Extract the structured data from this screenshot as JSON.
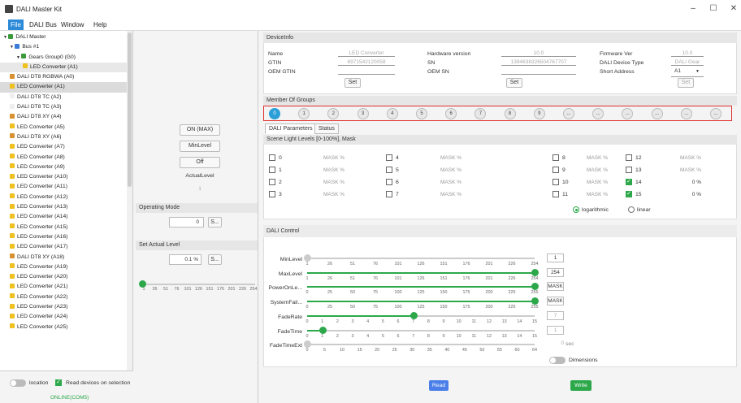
{
  "window": {
    "title": "DALI Master Kit",
    "min": "–",
    "max": "☐",
    "close": "✕"
  },
  "menu": [
    "File",
    "DALI Bus",
    "Window",
    "Help"
  ],
  "tree": [
    {
      "label": "DALI Master",
      "indent": 0,
      "arrow": "▼",
      "color": "#3a9a3a"
    },
    {
      "label": "Bus #1",
      "indent": 1,
      "arrow": "▼",
      "color": "#3a7ad8"
    },
    {
      "label": "Gears Group0 (G0)",
      "indent": 2,
      "arrow": "▼",
      "color": "#3a9a3a"
    },
    {
      "label": "LED Converter (A1)",
      "indent": 3,
      "arrow": "",
      "color": "#f0c020",
      "sel": 1
    },
    {
      "label": "DALI DT8 RGBWA (A0)",
      "indent": 1,
      "arrow": "",
      "color": "#d89030"
    },
    {
      "label": "LED Converter (A1)",
      "indent": 1,
      "arrow": "",
      "color": "#f0c020",
      "sel": 2
    },
    {
      "label": "DALI DT8 TC (A2)",
      "indent": 1,
      "arrow": "",
      "color": "#eee"
    },
    {
      "label": "DALI DT8 TC (A3)",
      "indent": 1,
      "arrow": "",
      "color": "#eee"
    },
    {
      "label": "DALI DT8 XY (A4)",
      "indent": 1,
      "arrow": "",
      "color": "#d89030"
    },
    {
      "label": "LED Converter (A5)",
      "indent": 1,
      "arrow": "",
      "color": "#f0c020"
    },
    {
      "label": "DALI DT8 XY (A6)",
      "indent": 1,
      "arrow": "",
      "color": "#d89030"
    },
    {
      "label": "LED Converter (A7)",
      "indent": 1,
      "arrow": "",
      "color": "#f0c020"
    },
    {
      "label": "LED Converter (A8)",
      "indent": 1,
      "arrow": "",
      "color": "#f0c020"
    },
    {
      "label": "LED Converter (A9)",
      "indent": 1,
      "arrow": "",
      "color": "#f0c020"
    },
    {
      "label": "LED Converter (A10)",
      "indent": 1,
      "arrow": "",
      "color": "#f0c020"
    },
    {
      "label": "LED Converter (A11)",
      "indent": 1,
      "arrow": "",
      "color": "#f0c020"
    },
    {
      "label": "LED Converter (A12)",
      "indent": 1,
      "arrow": "",
      "color": "#f0c020"
    },
    {
      "label": "LED Converter (A13)",
      "indent": 1,
      "arrow": "",
      "color": "#f0c020"
    },
    {
      "label": "LED Converter (A14)",
      "indent": 1,
      "arrow": "",
      "color": "#f0c020"
    },
    {
      "label": "LED Converter (A15)",
      "indent": 1,
      "arrow": "",
      "color": "#f0c020"
    },
    {
      "label": "LED Converter (A16)",
      "indent": 1,
      "arrow": "",
      "color": "#f0c020"
    },
    {
      "label": "LED Converter (A17)",
      "indent": 1,
      "arrow": "",
      "color": "#f0c020"
    },
    {
      "label": "DALI DT8 XY (A18)",
      "indent": 1,
      "arrow": "",
      "color": "#d89030"
    },
    {
      "label": "LED Converter (A19)",
      "indent": 1,
      "arrow": "",
      "color": "#f0c020"
    },
    {
      "label": "LED Converter (A20)",
      "indent": 1,
      "arrow": "",
      "color": "#f0c020"
    },
    {
      "label": "LED Converter (A21)",
      "indent": 1,
      "arrow": "",
      "color": "#f0c020"
    },
    {
      "label": "LED Converter (A22)",
      "indent": 1,
      "arrow": "",
      "color": "#f0c020"
    },
    {
      "label": "LED Converter (A23)",
      "indent": 1,
      "arrow": "",
      "color": "#f0c020"
    },
    {
      "label": "LED Converter (A24)",
      "indent": 1,
      "arrow": "",
      "color": "#f0c020"
    },
    {
      "label": "LED Converter (A25)",
      "indent": 1,
      "arrow": "",
      "color": "#f0c020"
    }
  ],
  "bottom": {
    "location": "location",
    "read_on_sel": "Read devices on selection",
    "status": "ONLINE(COM5)"
  },
  "middle": {
    "on_max": "ON (MAX)",
    "min_level": "MinLevel",
    "off": "Off",
    "actual_level": "ActualLevel",
    "actual_value": "1",
    "operating_mode": "Operating Mode",
    "op_value": "0",
    "op_btn": "S...",
    "set_actual": "Set Actual Level",
    "set_value": "0.1",
    "set_unit": "%",
    "set_btn": "S...",
    "slider_ticks": [
      "1",
      "26",
      "51",
      "76",
      "101",
      "126",
      "151",
      "176",
      "201",
      "226",
      "254"
    ]
  },
  "device_info": {
    "header": "DeviceInfo",
    "name_label": "Name",
    "name_value": "LED Converter",
    "gtin_label": "GTIN",
    "gtin_value": "6971542120058",
    "oem_gtin_label": "OEM GTIN",
    "hw_label": "Hardware version",
    "hw_value": "10.0",
    "sn_label": "SN",
    "sn_value": "1394638326504767707",
    "oem_sn_label": "OEM SN",
    "fw_label": "Firmware Ver",
    "fw_value": "10.0",
    "type_label": "DALI Device Type",
    "type_value": "DALI Gear",
    "short_label": "Short Address",
    "short_value": "A1",
    "set1": "Set",
    "set2": "Set",
    "set3": "Set"
  },
  "groups": {
    "header": "Member Of Groups",
    "items": [
      "0",
      "1",
      "2",
      "3",
      "4",
      "5",
      "6",
      "7",
      "8",
      "9",
      "...",
      "...",
      "...",
      "...",
      "...",
      "..."
    ]
  },
  "tabs": [
    "DALI Parameters",
    "Status"
  ],
  "scenes": {
    "header": "Scene Light Levels [0-100%], Mask",
    "rows": [
      {
        "n": "0",
        "v": "MASK %",
        "on": false
      },
      {
        "n": "1",
        "v": "MASK %",
        "on": false
      },
      {
        "n": "2",
        "v": "MASK %",
        "on": false
      },
      {
        "n": "3",
        "v": "MASK %",
        "on": false
      },
      {
        "n": "4",
        "v": "MASK %",
        "on": false
      },
      {
        "n": "5",
        "v": "MASK %",
        "on": false
      },
      {
        "n": "6",
        "v": "MASK %",
        "on": false
      },
      {
        "n": "7",
        "v": "MASK %",
        "on": false
      },
      {
        "n": "8",
        "v": "MASK %",
        "on": false
      },
      {
        "n": "9",
        "v": "MASK %",
        "on": false
      },
      {
        "n": "10",
        "v": "MASK %",
        "on": false
      },
      {
        "n": "11",
        "v": "MASK %",
        "on": false
      },
      {
        "n": "12",
        "v": "MASK %",
        "on": false
      },
      {
        "n": "13",
        "v": "MASK %",
        "on": false
      },
      {
        "n": "14",
        "v": "0 %",
        "on": true
      },
      {
        "n": "15",
        "v": "0 %",
        "on": true
      }
    ],
    "log": "logarithmic",
    "lin": "linear"
  },
  "dali_control": {
    "header": "DALI Control",
    "sliders": [
      {
        "label": "MinLevel",
        "ticks": [
          "1",
          "26",
          "51",
          "76",
          "101",
          "126",
          "151",
          "176",
          "201",
          "226",
          "254"
        ],
        "level": 0,
        "value": "1",
        "active": false
      },
      {
        "label": "MaxLevel",
        "ticks": [
          "1",
          "26",
          "51",
          "76",
          "101",
          "126",
          "151",
          "176",
          "201",
          "226",
          "254"
        ],
        "level": 1,
        "value": "254",
        "active": true
      },
      {
        "label": "PowerOnLe...",
        "ticks": [
          "0",
          "25",
          "50",
          "75",
          "100",
          "125",
          "150",
          "175",
          "200",
          "225",
          "255"
        ],
        "level": 1,
        "value": "MASK",
        "active": true
      },
      {
        "label": "SystemFail...",
        "ticks": [
          "0",
          "25",
          "50",
          "75",
          "100",
          "125",
          "150",
          "175",
          "200",
          "225",
          "255"
        ],
        "level": 1,
        "value": "MASK",
        "active": true
      },
      {
        "label": "FadeRate",
        "ticks": [
          "0",
          "1",
          "2",
          "3",
          "4",
          "5",
          "6",
          "7",
          "8",
          "9",
          "10",
          "11",
          "12",
          "13",
          "14",
          "15"
        ],
        "level": 0.467,
        "value": "7",
        "active": true,
        "dim": true
      },
      {
        "label": "FadeTime",
        "ticks": [
          "0",
          "1",
          "2",
          "3",
          "4",
          "5",
          "6",
          "7",
          "8",
          "9",
          "10",
          "11",
          "12",
          "13",
          "14",
          "15"
        ],
        "level": 0.067,
        "value": "1",
        "active": true,
        "dim": true
      },
      {
        "label": "FadeTimeExt",
        "ticks": [
          "0",
          "5",
          "10",
          "15",
          "20",
          "25",
          "30",
          "35",
          "40",
          "45",
          "50",
          "55",
          "60",
          "64"
        ],
        "level": 0,
        "value": "0",
        "active": false,
        "dim": true,
        "unit": "sec"
      }
    ],
    "dimensions": "Dimensions"
  },
  "actions": {
    "read": "Read",
    "write": "Write"
  }
}
